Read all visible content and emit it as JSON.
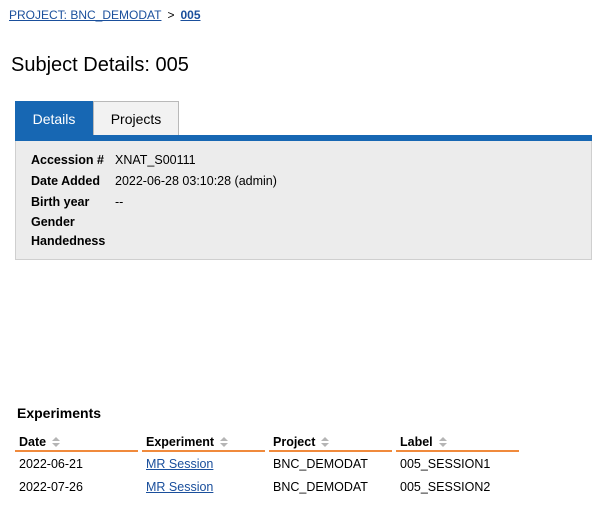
{
  "breadcrumb": {
    "project_link": "PROJECT: BNC_DEMODAT",
    "separator": ">",
    "current": "005"
  },
  "page": {
    "title": "Subject Details: 005"
  },
  "tabs": [
    {
      "label": "Details",
      "active": true
    },
    {
      "label": "Projects",
      "active": false
    }
  ],
  "details": {
    "rows": [
      {
        "label": "Accession #",
        "value": "XNAT_S00111"
      },
      {
        "label": "Date Added",
        "value": "2022-06-28 03:10:28 (admin)"
      },
      {
        "label": "Birth year",
        "value": "--"
      },
      {
        "label": "Gender",
        "value": ""
      },
      {
        "label": "Handedness",
        "value": ""
      }
    ]
  },
  "experiments": {
    "heading": "Experiments",
    "columns": [
      "Date",
      "Experiment",
      "Project",
      "Label"
    ],
    "rows": [
      {
        "date": "2022-06-21",
        "experiment": "MR Session",
        "project": "BNC_DEMODAT",
        "label": "005_SESSION1"
      },
      {
        "date": "2022-07-26",
        "experiment": "MR Session",
        "project": "BNC_DEMODAT",
        "label": "005_SESSION2"
      }
    ]
  },
  "colors": {
    "accent": "#1767b3",
    "link": "#1a4f9c",
    "table_header_underline": "#f08a3c",
    "panel_bg": "#ececec"
  },
  "icons": {
    "sort": "sort-arrows-icon"
  }
}
